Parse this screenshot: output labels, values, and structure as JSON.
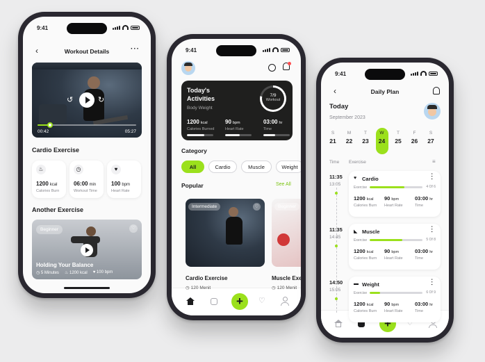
{
  "status_time": "9:41",
  "colors": {
    "accent": "#9be01c",
    "dark": "#1f1f1e",
    "background": "#ececed"
  },
  "phone1": {
    "title": "Workout Details",
    "video": {
      "elapsed": "00:42",
      "total": "05:27",
      "progress": 0.13
    },
    "cardio_title": "Cardio Exercise",
    "stats": [
      {
        "icon": "flame-icon",
        "value": "1200",
        "unit": "kcal",
        "label": "Calories Burn"
      },
      {
        "icon": "clock-icon",
        "value": "06:00",
        "unit": "min",
        "label": "Workout Time"
      },
      {
        "icon": "heart-rate-icon",
        "value": "100",
        "unit": "bpm",
        "label": "Heart Rate"
      }
    ],
    "another_title": "Another Exercise",
    "another_card": {
      "badge": "Beginner",
      "title": "Holding Your Balance",
      "minutes": "5 Minutes",
      "kcal": "1200 kcal",
      "bpm": "100 bpm"
    }
  },
  "phone2": {
    "activities": {
      "title_line1": "Today's",
      "title_line2": "Activities",
      "subtitle": "Body Weight",
      "ring_value": "7/9",
      "ring_label": "Workout",
      "ring_progress": 0.78,
      "metrics": [
        {
          "value": "1200",
          "unit": "kcal",
          "label": "Calories Burned",
          "progress": 0.65
        },
        {
          "value": "90",
          "unit": "bpm",
          "label": "Heart Rate",
          "progress": 0.55
        },
        {
          "value": "03:00",
          "unit": "hr",
          "label": "Time",
          "progress": 0.45
        }
      ]
    },
    "category_title": "Category",
    "categories": [
      "All",
      "Cardio",
      "Muscle",
      "Weight"
    ],
    "popular_title": "Popular",
    "see_all": "See All",
    "popular": [
      {
        "badge": "Intermediate",
        "title": "Cardio Exercise",
        "duration": "120 Menit"
      },
      {
        "badge": "Beginner",
        "title": "Muscle Exe",
        "duration": "120 Menit"
      }
    ]
  },
  "phone3": {
    "title": "Daily Plan",
    "today": "Today",
    "date": "September 2023",
    "days": [
      {
        "letter": "S",
        "num": "21"
      },
      {
        "letter": "M",
        "num": "22"
      },
      {
        "letter": "T",
        "num": "23"
      },
      {
        "letter": "W",
        "num": "24"
      },
      {
        "letter": "T",
        "num": "25"
      },
      {
        "letter": "F",
        "num": "26"
      },
      {
        "letter": "S",
        "num": "27"
      }
    ],
    "col_time": "Time",
    "col_exercise": "Exercise",
    "plans": [
      {
        "start": "11:35",
        "end": "13:05",
        "name": "Cardio",
        "icon": "heart-icon",
        "sub": "Exercise",
        "count": "4 Of 6",
        "progress": 0.66,
        "kcal": "1200",
        "bpm": "90",
        "time": "03:00"
      },
      {
        "start": "11:35",
        "end": "14:45",
        "name": "Muscle",
        "icon": "muscle-icon",
        "sub": "Exercise",
        "count": "5 Of 8",
        "progress": 0.62,
        "kcal": "1200",
        "bpm": "90",
        "time": "03:00"
      },
      {
        "start": "14:50",
        "end": "15:05",
        "name": "Weight",
        "icon": "dumbbell-icon",
        "sub": "Exercise",
        "count": "6 Of 9",
        "progress": 0.2,
        "kcal": "1200",
        "bpm": "90",
        "time": "03:00"
      }
    ],
    "labels": {
      "kcal_unit": "kcal",
      "bpm_unit": "bpm",
      "hr_unit": "hr",
      "calories": "Calories Burn",
      "heart": "Heart Rate",
      "time": "Time"
    }
  }
}
